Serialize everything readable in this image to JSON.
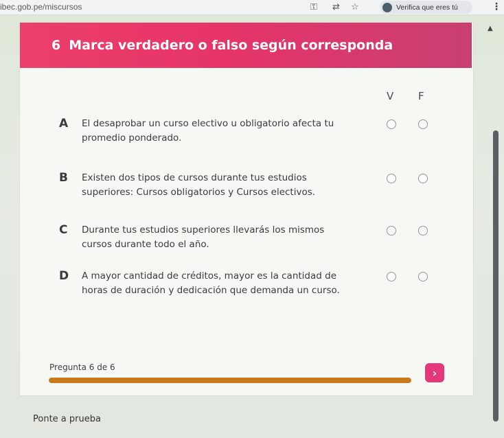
{
  "browser": {
    "url": "ibec.gob.pe/miscursos",
    "profile_label": "Verifica que eres tú",
    "icons": [
      "key-icon",
      "translate-icon",
      "star-icon",
      "kebab-menu-icon"
    ]
  },
  "question": {
    "number": "6",
    "title": "Marca verdadero o falso según corresponda",
    "col_true": "V",
    "col_false": "F",
    "items": [
      {
        "letter": "A",
        "text": "El desaprobar un curso electivo u obligatorio afecta tu promedio ponderado."
      },
      {
        "letter": "B",
        "text": "Existen dos tipos de cursos durante tus estudios superiores: Cursos obligatorios y Cursos electivos."
      },
      {
        "letter": "C",
        "text": "Durante tus estudios superiores llevarás los mismos cursos durante todo el año."
      },
      {
        "letter": "D",
        "text": "A mayor cantidad de créditos, mayor es la cantidad de horas de duración y dedicación que demanda un curso."
      }
    ]
  },
  "progress": {
    "label": "Pregunta 6 de 6",
    "fraction": 1.0
  },
  "navigation": {
    "next_symbol": "›"
  },
  "footer": {
    "text": "Ponte a prueba"
  },
  "colors": {
    "header": "#e63468",
    "progress": "#c97a1f",
    "next_button": "#e5387b"
  }
}
